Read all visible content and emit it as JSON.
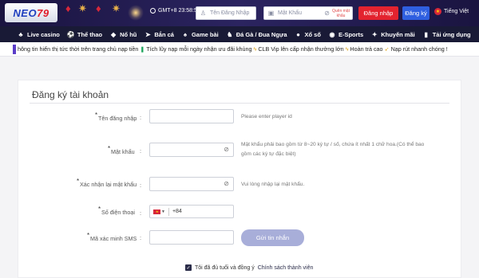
{
  "header": {
    "logo_main": "NEO",
    "logo_num": "79",
    "gmt": "GMT+8 23:58:57",
    "username_placeholder": "Tên Đăng Nhập",
    "password_placeholder": "Mật Khẩu",
    "forgot_password": "Quên mật khẩu",
    "login_label": "Đăng nhập",
    "register_label": "Đăng ký",
    "language": "Tiếng Việt"
  },
  "nav": {
    "items": [
      {
        "label": "Live casino",
        "icon": "live-casino-icon",
        "glyph": "♣"
      },
      {
        "label": "Thể thao",
        "icon": "sports-icon",
        "glyph": "⚽"
      },
      {
        "label": "Nổ hũ",
        "icon": "slot-icon",
        "glyph": "◆"
      },
      {
        "label": "Bắn cá",
        "icon": "fish-icon",
        "glyph": "➤"
      },
      {
        "label": "Game bài",
        "icon": "cards-icon",
        "glyph": "♠"
      },
      {
        "label": "Đá Gà / Đua Ngựa",
        "icon": "cockfight-icon",
        "glyph": "♞"
      },
      {
        "label": "Xổ số",
        "icon": "lottery-icon",
        "glyph": "●"
      },
      {
        "label": "E-Sports",
        "icon": "esports-icon",
        "glyph": "◉"
      },
      {
        "label": "Khuyến mãi",
        "icon": "promo-icon",
        "glyph": "✦"
      },
      {
        "label": "Tải ứng dụng",
        "icon": "download-app-icon",
        "glyph": "▮"
      }
    ]
  },
  "marquee": {
    "part1": "hông tin hiển thị tức thời trên trang chủ nạp tiền",
    "part2": "Tích lũy nạp mỗi ngày nhận ưu đãi khủng",
    "part3": "CLB Vip lên cấp nhận thưởng lớn",
    "part4": "Hoàn trả cao",
    "part5": "Nạp rút nhanh chóng !"
  },
  "form": {
    "title": "Đăng ký tài khoản",
    "username_label": "Tên đăng nhập",
    "username_hint": "Please enter player id",
    "password_label": "Mật khẩu",
    "password_hint_1": "Mật khẩu phải bao gồm từ 8~20 ký tự / số, chứa ít nhất 1 chữ hoa.(Có thể bao",
    "password_hint_2": "gồm các ký tự đặc biệt)",
    "confirm_label": "Xác nhận lại mật khẩu",
    "confirm_hint": "Vui lòng nhập lại mật khẩu.",
    "phone_label": "Số điện thoại",
    "phone_prefix": "+84",
    "sms_label": "Mã xác minh SMS",
    "sms_button": "Gửi tin nhắn",
    "agree_text": "Tôi đã đủ tuổi và đồng ý",
    "agree_link": "Chính sách thành viên",
    "colon": ":"
  },
  "colors": {
    "login": "#e3232f",
    "register": "#2f5fe0",
    "nav_bg": "#191a36",
    "sms_button": "#a8aed9"
  }
}
